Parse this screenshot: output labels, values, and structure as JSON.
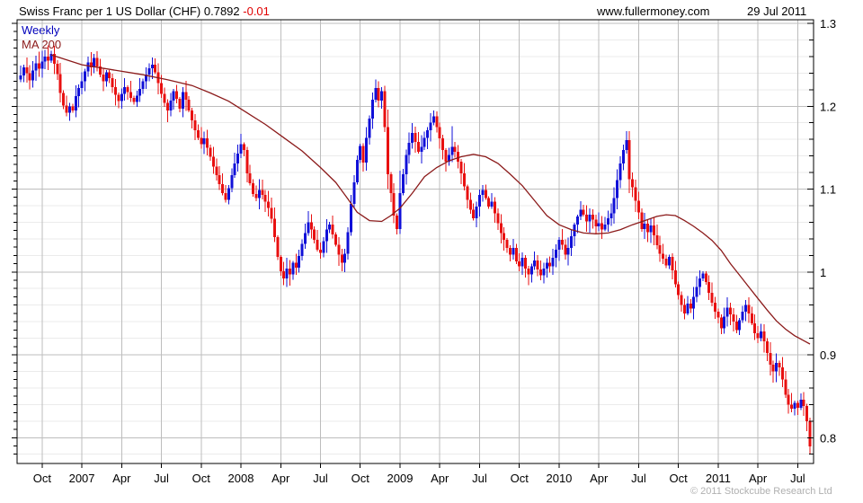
{
  "header": {
    "title": "Swiss Franc per 1 US Dollar (CHF) 0.7892",
    "change": "-0.01",
    "website": "www.fullermoney.com",
    "date": "29 Jul 2011"
  },
  "legend": {
    "timeframe": "Weekly",
    "ma_label": "MA 200"
  },
  "footer": {
    "copyright": "© 2011 Stockcube Research Ltd"
  },
  "colors": {
    "up_candle": "#1010d8",
    "down_candle": "#e81010",
    "ma_line": "#8b1a1a",
    "grid_major": "#bdbdbd",
    "grid_minor": "#ebebeb",
    "axis": "#000000",
    "change_text": "#e00000",
    "weekly_text": "#0000bb",
    "copyright_text": "#b0b0b0"
  },
  "chart_data": {
    "type": "candlestick",
    "interval": "Weekly",
    "title": "Swiss Franc per 1 US Dollar (CHF)",
    "last_price": 0.7892,
    "change": -0.01,
    "grid": true,
    "y_axis": {
      "min": 0.77,
      "max": 1.304,
      "major_step": 0.1,
      "minor_step": 0.02,
      "ticks": [
        {
          "value": 1.3,
          "label": "1.3"
        },
        {
          "value": 1.2,
          "label": "1.2"
        },
        {
          "value": 1.1,
          "label": "1.1"
        },
        {
          "value": 1.0,
          "label": "1"
        },
        {
          "value": 0.9,
          "label": "0.9"
        },
        {
          "value": 0.8,
          "label": "0.8"
        }
      ]
    },
    "x_axis": {
      "unit": "week-index",
      "ticks": [
        {
          "week": 7,
          "label": "Oct"
        },
        {
          "week": 20,
          "label": "2007"
        },
        {
          "week": 33,
          "label": "Apr"
        },
        {
          "week": 46,
          "label": "Jul"
        },
        {
          "week": 59,
          "label": "Oct"
        },
        {
          "week": 72,
          "label": "2008"
        },
        {
          "week": 85,
          "label": "Apr"
        },
        {
          "week": 98,
          "label": "Jul"
        },
        {
          "week": 111,
          "label": "Oct"
        },
        {
          "week": 124,
          "label": "2009"
        },
        {
          "week": 137,
          "label": "Apr"
        },
        {
          "week": 150,
          "label": "Jul"
        },
        {
          "week": 163,
          "label": "Oct"
        },
        {
          "week": 176,
          "label": "2010"
        },
        {
          "week": 189,
          "label": "Apr"
        },
        {
          "week": 202,
          "label": "Jul"
        },
        {
          "week": 215,
          "label": "Oct"
        },
        {
          "week": 228,
          "label": "2011"
        },
        {
          "week": 241,
          "label": "Apr"
        },
        {
          "week": 254,
          "label": "Jul"
        }
      ]
    },
    "weekly_closes": [
      1.237,
      1.247,
      1.24,
      1.231,
      1.243,
      1.252,
      1.245,
      1.254,
      1.26,
      1.255,
      1.263,
      1.251,
      1.239,
      1.216,
      1.201,
      1.192,
      1.2,
      1.195,
      1.212,
      1.222,
      1.23,
      1.242,
      1.253,
      1.247,
      1.258,
      1.248,
      1.238,
      1.23,
      1.241,
      1.234,
      1.223,
      1.214,
      1.206,
      1.215,
      1.223,
      1.217,
      1.21,
      1.205,
      1.213,
      1.221,
      1.23,
      1.238,
      1.246,
      1.25,
      1.241,
      1.228,
      1.215,
      1.204,
      1.195,
      1.207,
      1.218,
      1.209,
      1.197,
      1.217,
      1.208,
      1.195,
      1.183,
      1.171,
      1.162,
      1.154,
      1.161,
      1.15,
      1.139,
      1.127,
      1.117,
      1.106,
      1.095,
      1.087,
      1.101,
      1.117,
      1.131,
      1.143,
      1.154,
      1.147,
      1.119,
      1.107,
      1.094,
      1.089,
      1.099,
      1.093,
      1.085,
      1.077,
      1.064,
      1.042,
      1.018,
      1.001,
      0.992,
      1.004,
      0.997,
      1.011,
      1.005,
      1.019,
      1.034,
      1.047,
      1.06,
      1.051,
      1.039,
      1.027,
      1.023,
      1.037,
      1.051,
      1.057,
      1.045,
      1.033,
      1.021,
      1.011,
      1.022,
      1.048,
      1.082,
      1.108,
      1.135,
      1.152,
      1.132,
      1.162,
      1.185,
      1.208,
      1.222,
      1.207,
      1.218,
      1.175,
      1.118,
      1.095,
      1.068,
      1.052,
      1.095,
      1.118,
      1.141,
      1.156,
      1.168,
      1.157,
      1.145,
      1.151,
      1.162,
      1.171,
      1.18,
      1.188,
      1.175,
      1.161,
      1.147,
      1.133,
      1.141,
      1.151,
      1.145,
      1.133,
      1.119,
      1.103,
      1.087,
      1.075,
      1.065,
      1.079,
      1.093,
      1.099,
      1.089,
      1.079,
      1.085,
      1.071,
      1.059,
      1.047,
      1.039,
      1.029,
      1.021,
      1.029,
      1.013,
      1.007,
      1.017,
      1.004,
      0.997,
      1.007,
      1.014,
      1.003,
      0.996,
      1.004,
      1.011,
      1.007,
      1.017,
      1.027,
      1.039,
      1.033,
      1.021,
      1.029,
      1.043,
      1.057,
      1.067,
      1.075,
      1.069,
      1.061,
      1.069,
      1.063,
      1.055,
      1.059,
      1.051,
      1.057,
      1.065,
      1.071,
      1.089,
      1.111,
      1.131,
      1.147,
      1.159,
      1.112,
      1.102,
      1.086,
      1.072,
      1.052,
      1.058,
      1.048,
      1.056,
      1.044,
      1.032,
      1.022,
      1.016,
      1.008,
      1.018,
      1.002,
      0.985,
      0.972,
      0.96,
      0.95,
      0.962,
      0.956,
      0.97,
      0.982,
      0.992,
      0.998,
      0.988,
      0.975,
      0.963,
      0.952,
      0.945,
      0.932,
      0.946,
      0.957,
      0.949,
      0.94,
      0.93,
      0.942,
      0.952,
      0.96,
      0.95,
      0.938,
      0.926,
      0.92,
      0.928,
      0.916,
      0.902,
      0.888,
      0.88,
      0.89,
      0.885,
      0.87,
      0.852,
      0.84,
      0.835,
      0.842,
      0.836,
      0.846,
      0.838,
      0.82,
      0.7892
    ],
    "first_open": 1.232,
    "wick_overrides": {
      "8": {
        "high": 1.268
      },
      "10": {
        "high": 1.267
      },
      "15": {
        "low": 1.188
      },
      "24": {
        "high": 1.263
      },
      "48": {
        "low": 1.181
      },
      "67": {
        "low": 1.084
      },
      "86": {
        "low": 0.984
      },
      "116": {
        "high": 1.232
      },
      "120": {
        "high": 1.196,
        "low": 1.1
      },
      "123": {
        "low": 1.045
      },
      "124": {
        "high": 1.122,
        "low": 1.046
      },
      "135": {
        "high": 1.195
      },
      "141": {
        "high": 1.176
      },
      "170": {
        "low": 0.99
      },
      "198": {
        "high": 1.17
      },
      "199": {
        "low": 1.095
      },
      "217": {
        "low": 0.943
      },
      "223": {
        "high": 1.001
      },
      "229": {
        "low": 0.925
      },
      "251": {
        "low": 0.829
      },
      "258": {
        "low": 0.781,
        "high": 0.824
      }
    },
    "ma200_points": [
      [
        10,
        1.262
      ],
      [
        20,
        1.25
      ],
      [
        30,
        1.244
      ],
      [
        40,
        1.238
      ],
      [
        48,
        1.232
      ],
      [
        56,
        1.225
      ],
      [
        62,
        1.216
      ],
      [
        68,
        1.206
      ],
      [
        74,
        1.192
      ],
      [
        80,
        1.178
      ],
      [
        86,
        1.162
      ],
      [
        92,
        1.146
      ],
      [
        98,
        1.126
      ],
      [
        103,
        1.108
      ],
      [
        107,
        1.088
      ],
      [
        110,
        1.072
      ],
      [
        114,
        1.062
      ],
      [
        118,
        1.061
      ],
      [
        121,
        1.068
      ],
      [
        124,
        1.077
      ],
      [
        128,
        1.095
      ],
      [
        132,
        1.115
      ],
      [
        136,
        1.126
      ],
      [
        140,
        1.134
      ],
      [
        144,
        1.139
      ],
      [
        148,
        1.142
      ],
      [
        152,
        1.139
      ],
      [
        156,
        1.131
      ],
      [
        160,
        1.118
      ],
      [
        164,
        1.104
      ],
      [
        168,
        1.086
      ],
      [
        172,
        1.068
      ],
      [
        176,
        1.057
      ],
      [
        180,
        1.051
      ],
      [
        184,
        1.047
      ],
      [
        188,
        1.046
      ],
      [
        192,
        1.047
      ],
      [
        196,
        1.051
      ],
      [
        200,
        1.057
      ],
      [
        204,
        1.062
      ],
      [
        208,
        1.067
      ],
      [
        211,
        1.069
      ],
      [
        214,
        1.068
      ],
      [
        217,
        1.062
      ],
      [
        220,
        1.055
      ],
      [
        223,
        1.047
      ],
      [
        226,
        1.038
      ],
      [
        229,
        1.026
      ],
      [
        232,
        1.01
      ],
      [
        235,
        0.996
      ],
      [
        238,
        0.982
      ],
      [
        241,
        0.968
      ],
      [
        244,
        0.954
      ],
      [
        247,
        0.941
      ],
      [
        250,
        0.931
      ],
      [
        253,
        0.923
      ],
      [
        256,
        0.917
      ],
      [
        258,
        0.913
      ]
    ]
  }
}
